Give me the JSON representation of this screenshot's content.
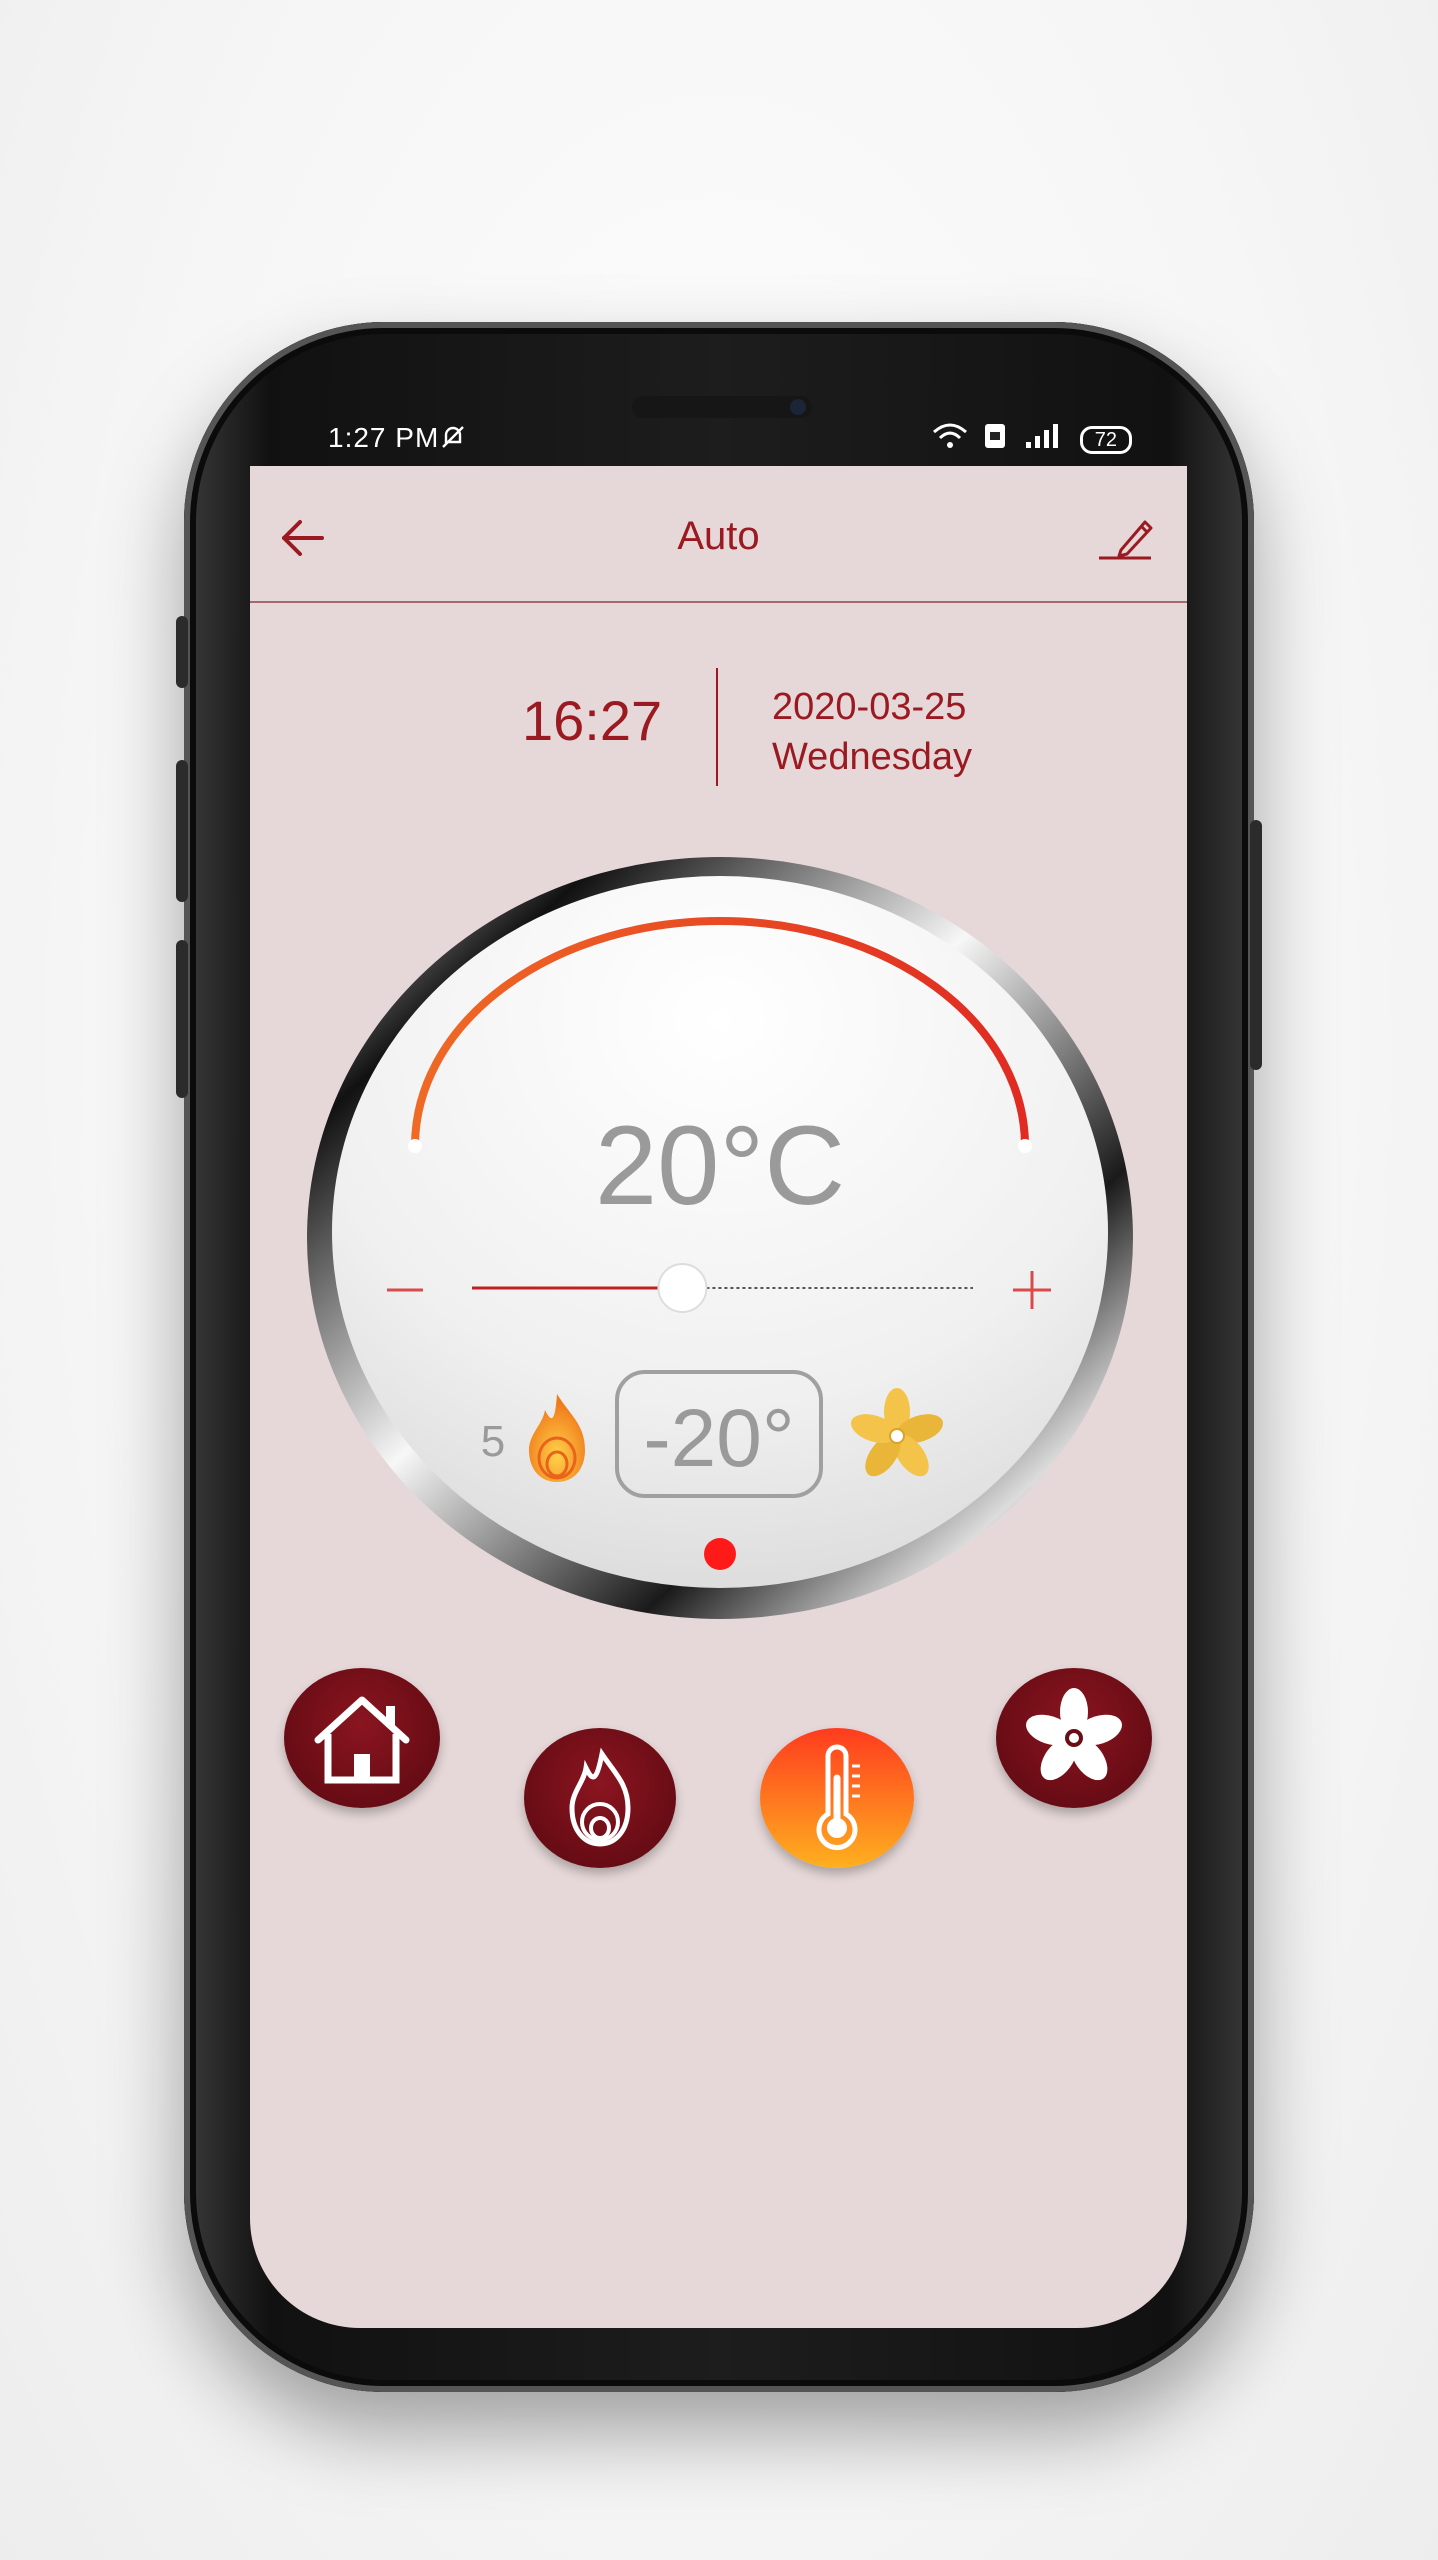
{
  "status_bar": {
    "time": "1:27 PM",
    "battery": "72"
  },
  "header": {
    "title": "Auto"
  },
  "datetime": {
    "time": "16:27",
    "date": "2020-03-25",
    "weekday": "Wednesday"
  },
  "thermostat": {
    "set_temperature": "20°C",
    "slider_value_fraction": 0.42,
    "decrease_label": "–",
    "increase_label": "+",
    "flame_level": "5",
    "offset": "-20°"
  },
  "mode_buttons": [
    {
      "name": "home",
      "icon": "home-icon",
      "active": false
    },
    {
      "name": "heat",
      "icon": "flame-icon",
      "active": false
    },
    {
      "name": "temperature",
      "icon": "thermometer-icon",
      "active": true
    },
    {
      "name": "fan",
      "icon": "fan-icon",
      "active": false
    }
  ],
  "colors": {
    "accent": "#9b1a22",
    "screen_bg": "#e6d8d8",
    "dark_button": "#6b0d14",
    "active_gradient_top": "#ff3b1f",
    "active_gradient_bottom": "#ffb01f",
    "arc_start": "#ef6a25",
    "arc_end": "#e02a22"
  }
}
